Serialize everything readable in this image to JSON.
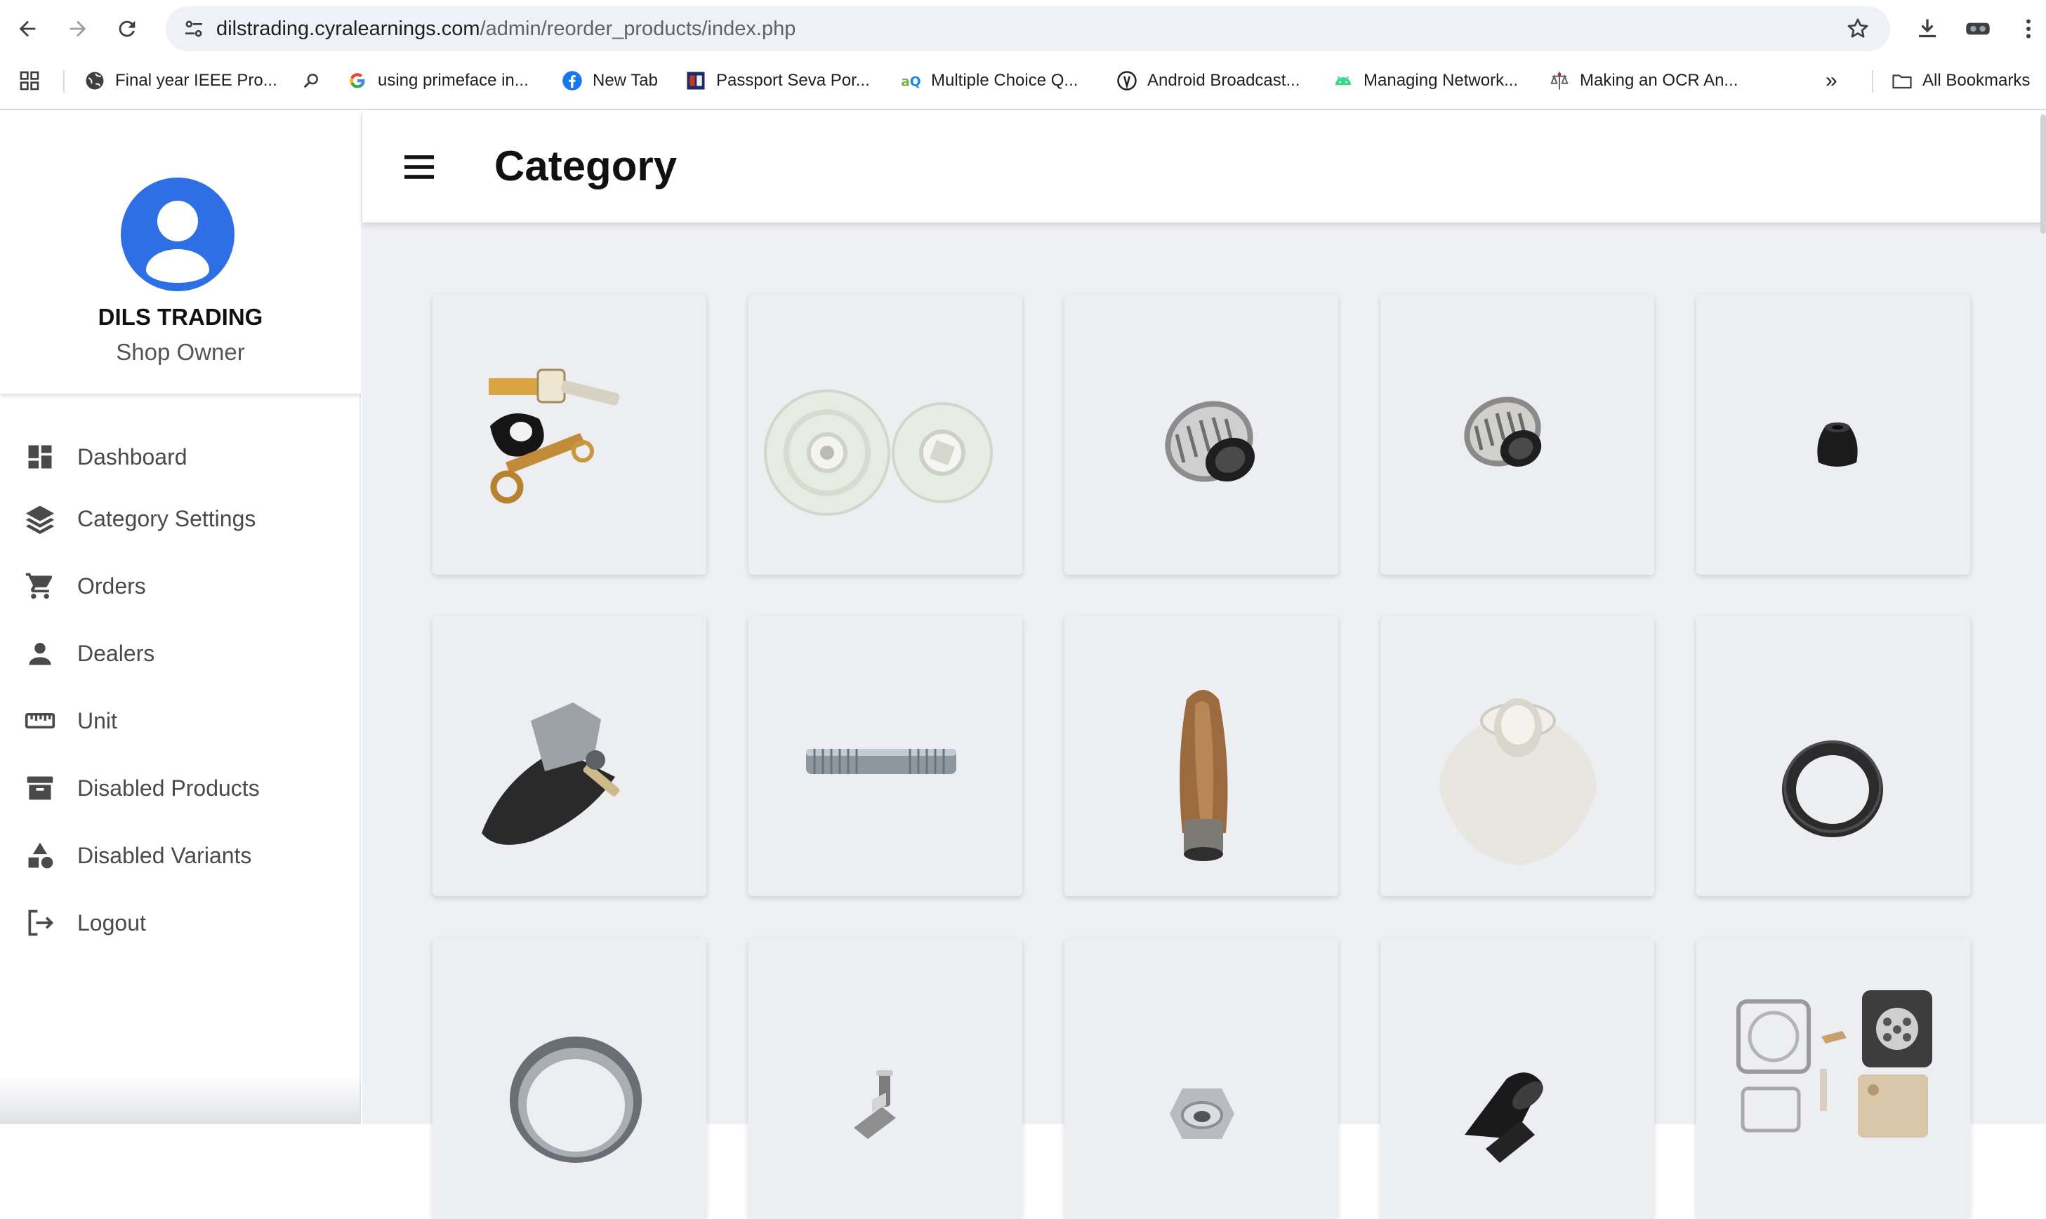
{
  "browser": {
    "url_host": "dilstrading.cyralearnings.com",
    "url_path": "/admin/reorder_products/index.php",
    "bookmarks": [
      {
        "label": "Final year IEEE Pro...",
        "icon": "globe-icon"
      },
      {
        "label": "",
        "icon": "search-icon"
      },
      {
        "label": "using primeface in...",
        "icon": "google-icon"
      },
      {
        "label": "New Tab",
        "icon": "facebook-icon"
      },
      {
        "label": "Passport Seva Por...",
        "icon": "passport-seva-icon"
      },
      {
        "label": "Multiple Choice Q...",
        "icon": "aq-icon"
      },
      {
        "label": "Android Broadcast...",
        "icon": "android-broadcast-icon"
      },
      {
        "label": "Managing Network...",
        "icon": "android-icon"
      },
      {
        "label": "Making an OCR An...",
        "icon": "ocr-icon"
      }
    ],
    "more_bookmarks": "»",
    "all_bookmarks": "All Bookmarks"
  },
  "sidebar": {
    "shop_name": "DILS TRADING",
    "role": "Shop Owner",
    "items": [
      {
        "label": "Dashboard",
        "icon": "dashboard-icon"
      },
      {
        "label": "Category Settings",
        "icon": "layers-icon"
      },
      {
        "label": "Orders",
        "icon": "cart-icon"
      },
      {
        "label": "Dealers",
        "icon": "person-icon"
      },
      {
        "label": "Unit",
        "icon": "ruler-icon"
      },
      {
        "label": "Disabled Products",
        "icon": "archive-icon"
      },
      {
        "label": "Disabled Variants",
        "icon": "category-icon"
      },
      {
        "label": "Logout",
        "icon": "logout-icon"
      }
    ]
  },
  "header": {
    "title": "Category"
  },
  "products": [
    {
      "image": "switch-terminal-part"
    },
    {
      "image": "white-plastic-pulley"
    },
    {
      "image": "needle-roller-bearing"
    },
    {
      "image": "needle-roller-bearing-small"
    },
    {
      "image": "black-rubber-cap"
    },
    {
      "image": "aluminium-lever"
    },
    {
      "image": "threaded-stud-bolt"
    },
    {
      "image": "wooden-file-handle"
    },
    {
      "image": "plastic-bushing"
    },
    {
      "image": "black-rubber-washer"
    },
    {
      "image": "metal-ring"
    },
    {
      "image": "pipe-fitting"
    },
    {
      "image": "hex-nut-washer"
    },
    {
      "image": "rubber-grommet"
    },
    {
      "image": "carburetor-gasket-kit"
    }
  ],
  "colors": {
    "accent": "#2f6fe6",
    "content_bg": "#eff0f4",
    "card_bg": "#eceef2",
    "sidebar_text": "#4a4a4a"
  }
}
